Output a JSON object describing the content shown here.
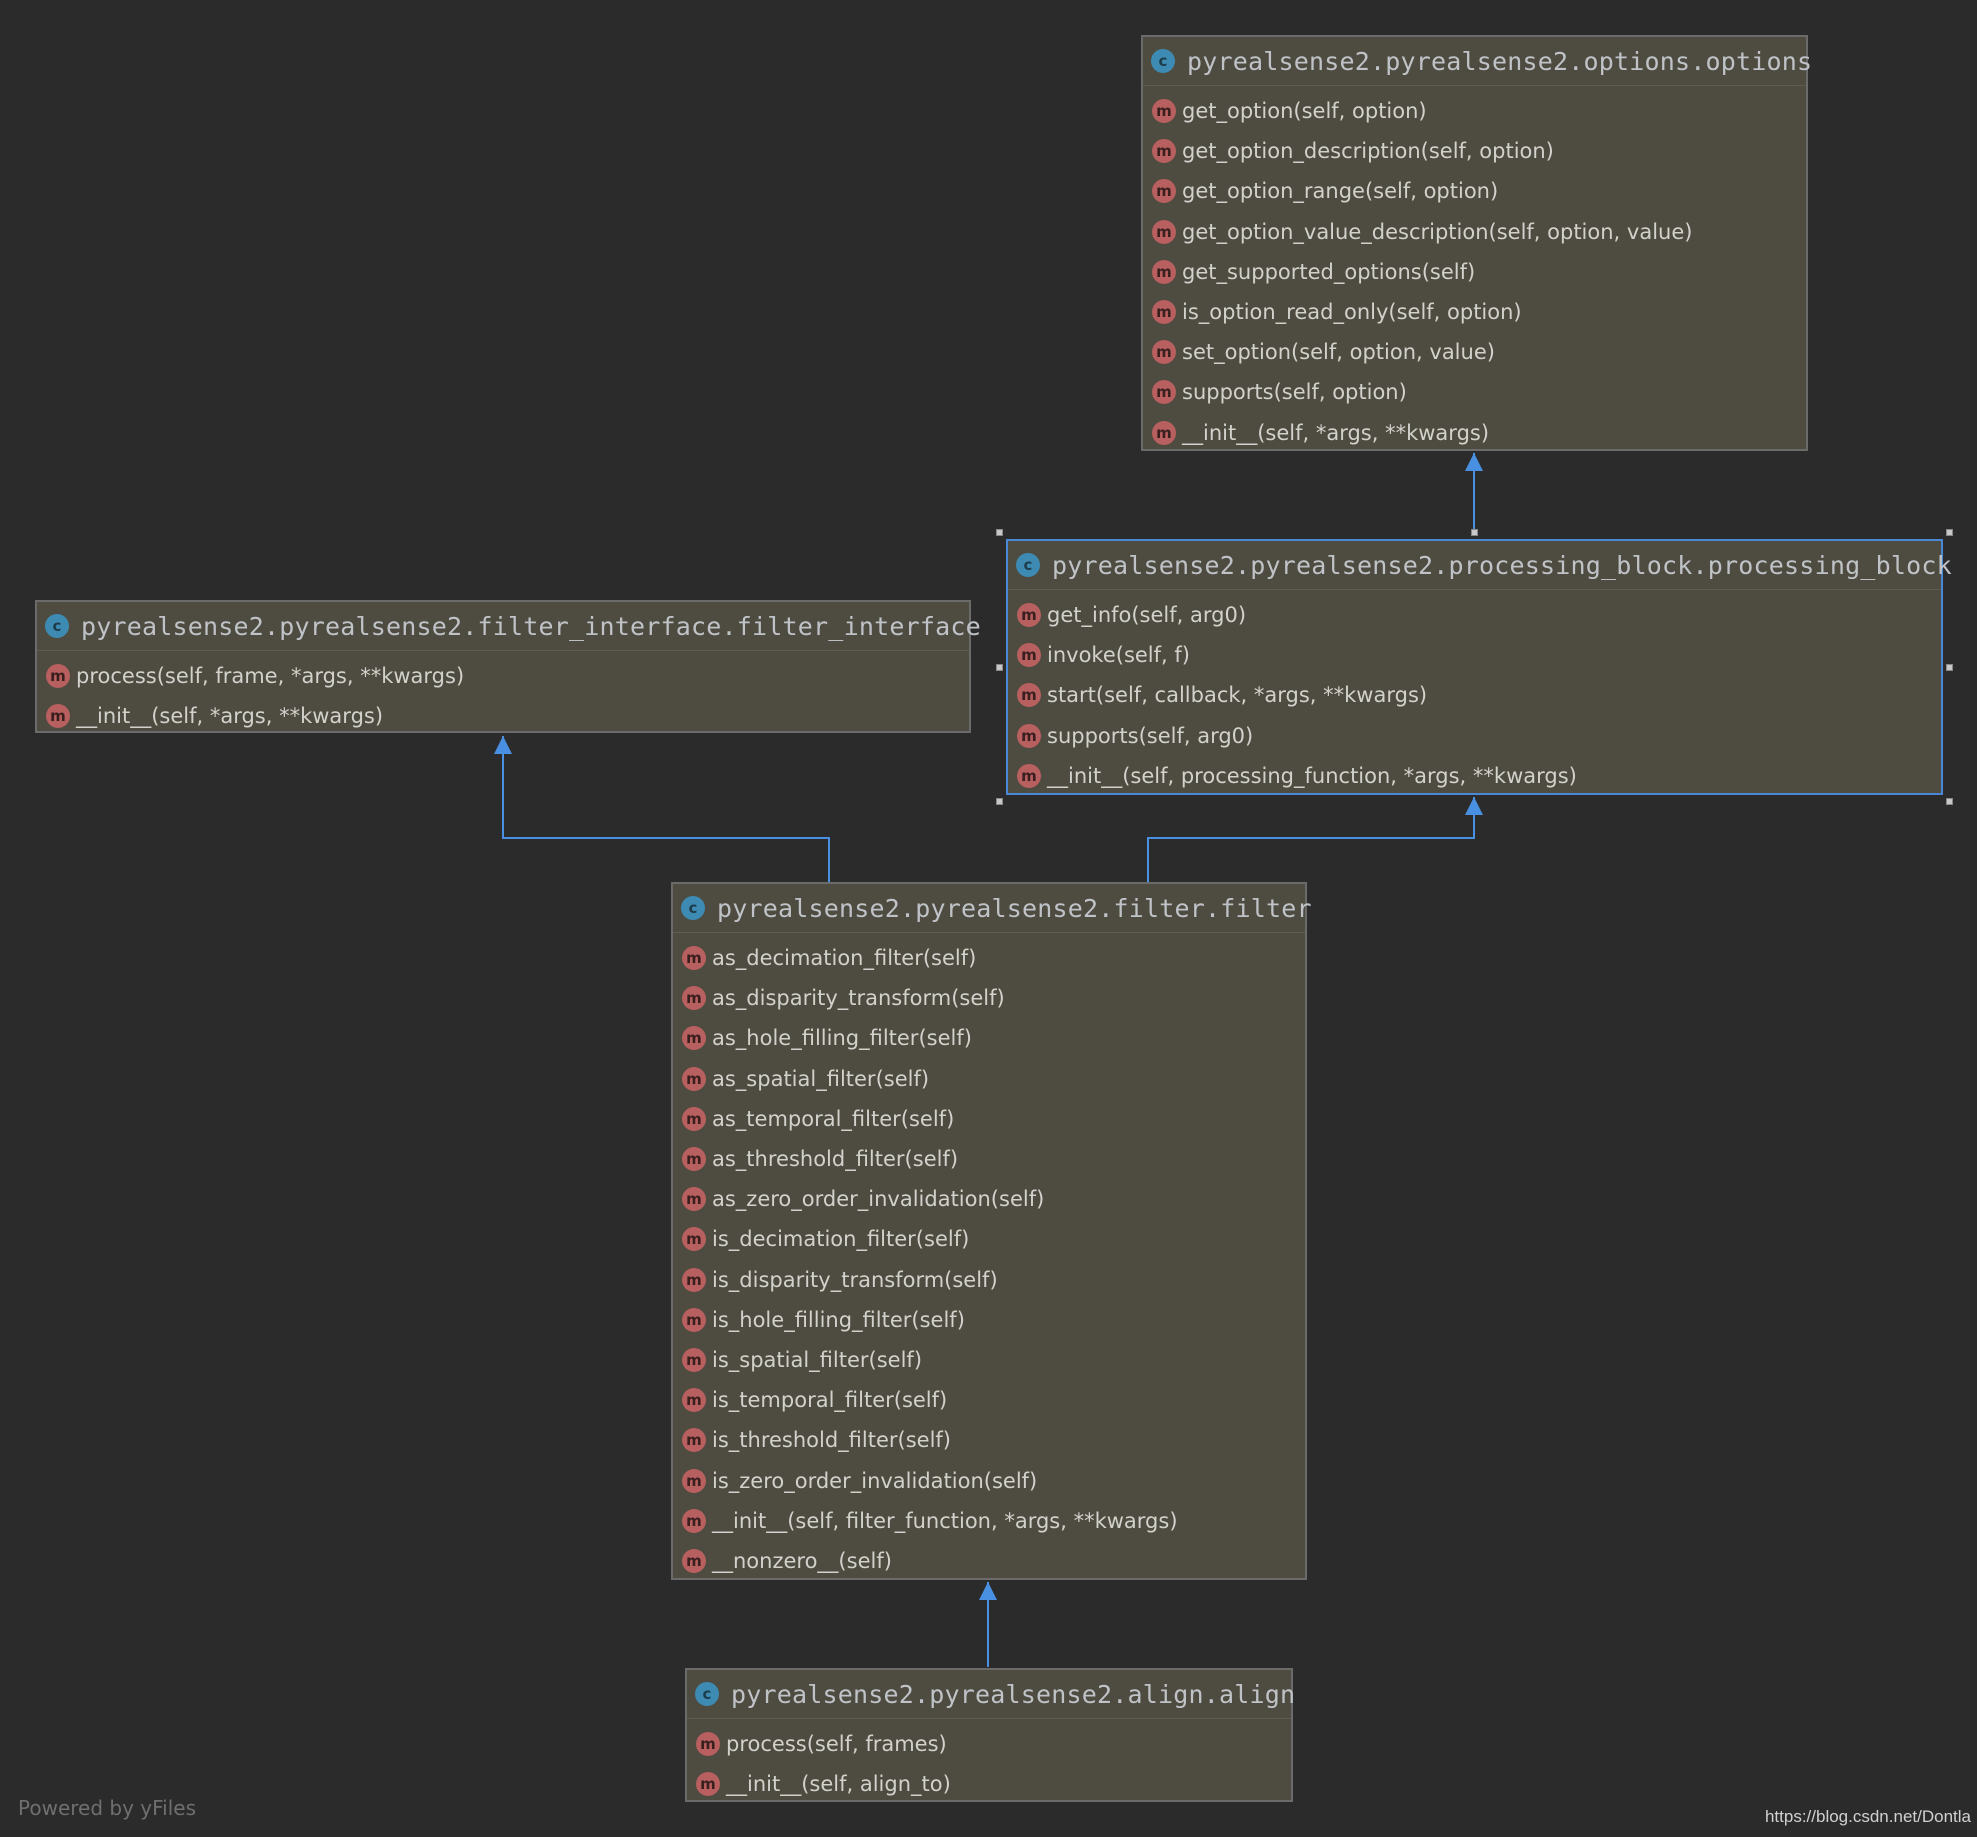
{
  "diagram": {
    "classes": [
      {
        "id": "options",
        "icon_letter": "c",
        "title": "pyrealsense2.pyrealsense2.options.options",
        "method_icon_letter": "m",
        "methods": [
          "get_option(self, option)",
          "get_option_description(self, option)",
          "get_option_range(self, option)",
          "get_option_value_description(self, option, value)",
          "get_supported_options(self)",
          "is_option_read_only(self, option)",
          "set_option(self, option, value)",
          "supports(self, option)",
          "__init__(self, *args, **kwargs)"
        ]
      },
      {
        "id": "processing_block",
        "icon_letter": "c",
        "title": "pyrealsense2.pyrealsense2.processing_block.processing_block",
        "method_icon_letter": "m",
        "selected": true,
        "methods": [
          "get_info(self, arg0)",
          "invoke(self, f)",
          "start(self, callback, *args, **kwargs)",
          "supports(self, arg0)",
          "__init__(self, processing_function, *args, **kwargs)"
        ]
      },
      {
        "id": "filter_interface",
        "icon_letter": "c",
        "title": "pyrealsense2.pyrealsense2.filter_interface.filter_interface",
        "method_icon_letter": "m",
        "methods": [
          "process(self, frame, *args, **kwargs)",
          "__init__(self, *args, **kwargs)"
        ]
      },
      {
        "id": "filter",
        "icon_letter": "c",
        "title": "pyrealsense2.pyrealsense2.filter.filter",
        "method_icon_letter": "m",
        "methods": [
          "as_decimation_filter(self)",
          "as_disparity_transform(self)",
          "as_hole_filling_filter(self)",
          "as_spatial_filter(self)",
          "as_temporal_filter(self)",
          "as_threshold_filter(self)",
          "as_zero_order_invalidation(self)",
          "is_decimation_filter(self)",
          "is_disparity_transform(self)",
          "is_hole_filling_filter(self)",
          "is_spatial_filter(self)",
          "is_temporal_filter(self)",
          "is_threshold_filter(self)",
          "is_zero_order_invalidation(self)",
          "__init__(self, filter_function, *args, **kwargs)",
          "__nonzero__(self)"
        ]
      },
      {
        "id": "align",
        "icon_letter": "c",
        "title": "pyrealsense2.pyrealsense2.align.align",
        "method_icon_letter": "m",
        "methods": [
          "process(self, frames)",
          "__init__(self, align_to)"
        ]
      }
    ],
    "inheritance": [
      {
        "from": "processing_block",
        "to": "options"
      },
      {
        "from": "filter",
        "to": "filter_interface"
      },
      {
        "from": "filter",
        "to": "processing_block"
      },
      {
        "from": "align",
        "to": "filter"
      }
    ]
  },
  "colors": {
    "background": "#2b2b2b",
    "node_fill": "#4e4b40",
    "edge": "#4a90e2",
    "class_icon": "#3d8bb3",
    "method_icon": "#b85f5f"
  },
  "footer": {
    "powered_by": "Powered by yFiles",
    "watermark": "https://blog.csdn.net/Dontla"
  }
}
